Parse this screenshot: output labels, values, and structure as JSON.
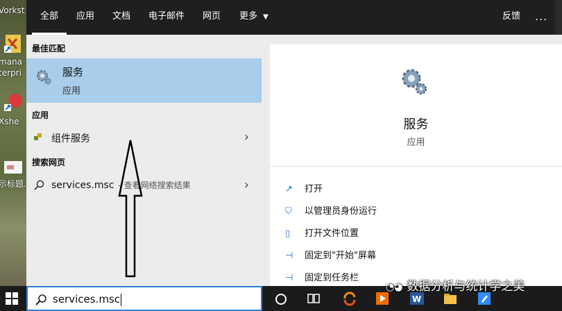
{
  "desktop": {
    "labels": [
      "Vorkst",
      "mana",
      "terpri",
      "Xshe",
      "示标题.p"
    ]
  },
  "tabs": [
    "全部",
    "应用",
    "文档",
    "电子邮件",
    "网页",
    "更多"
  ],
  "top_right": {
    "feedback": "反馈",
    "more": "..."
  },
  "sections": {
    "best": "最佳匹配",
    "apps": "应用",
    "web": "搜索网页"
  },
  "best_match": {
    "title": "服务",
    "subtitle": "应用"
  },
  "apps": [
    {
      "label": "组件服务"
    }
  ],
  "web": {
    "query": "services.msc",
    "hint": "- 查看网络搜索结果"
  },
  "detail": {
    "title": "服务",
    "subtitle": "应用",
    "actions": [
      "打开",
      "以管理员身份运行",
      "打开文件位置",
      "固定到\"开始\"屏幕",
      "固定到任务栏"
    ]
  },
  "search": {
    "value": "services.msc"
  },
  "watermark": "数据分析与统计学之美",
  "colors": {
    "accent": "#1b74d8",
    "highlight": "#a9cdea",
    "topbar": "#1f1f1f"
  }
}
